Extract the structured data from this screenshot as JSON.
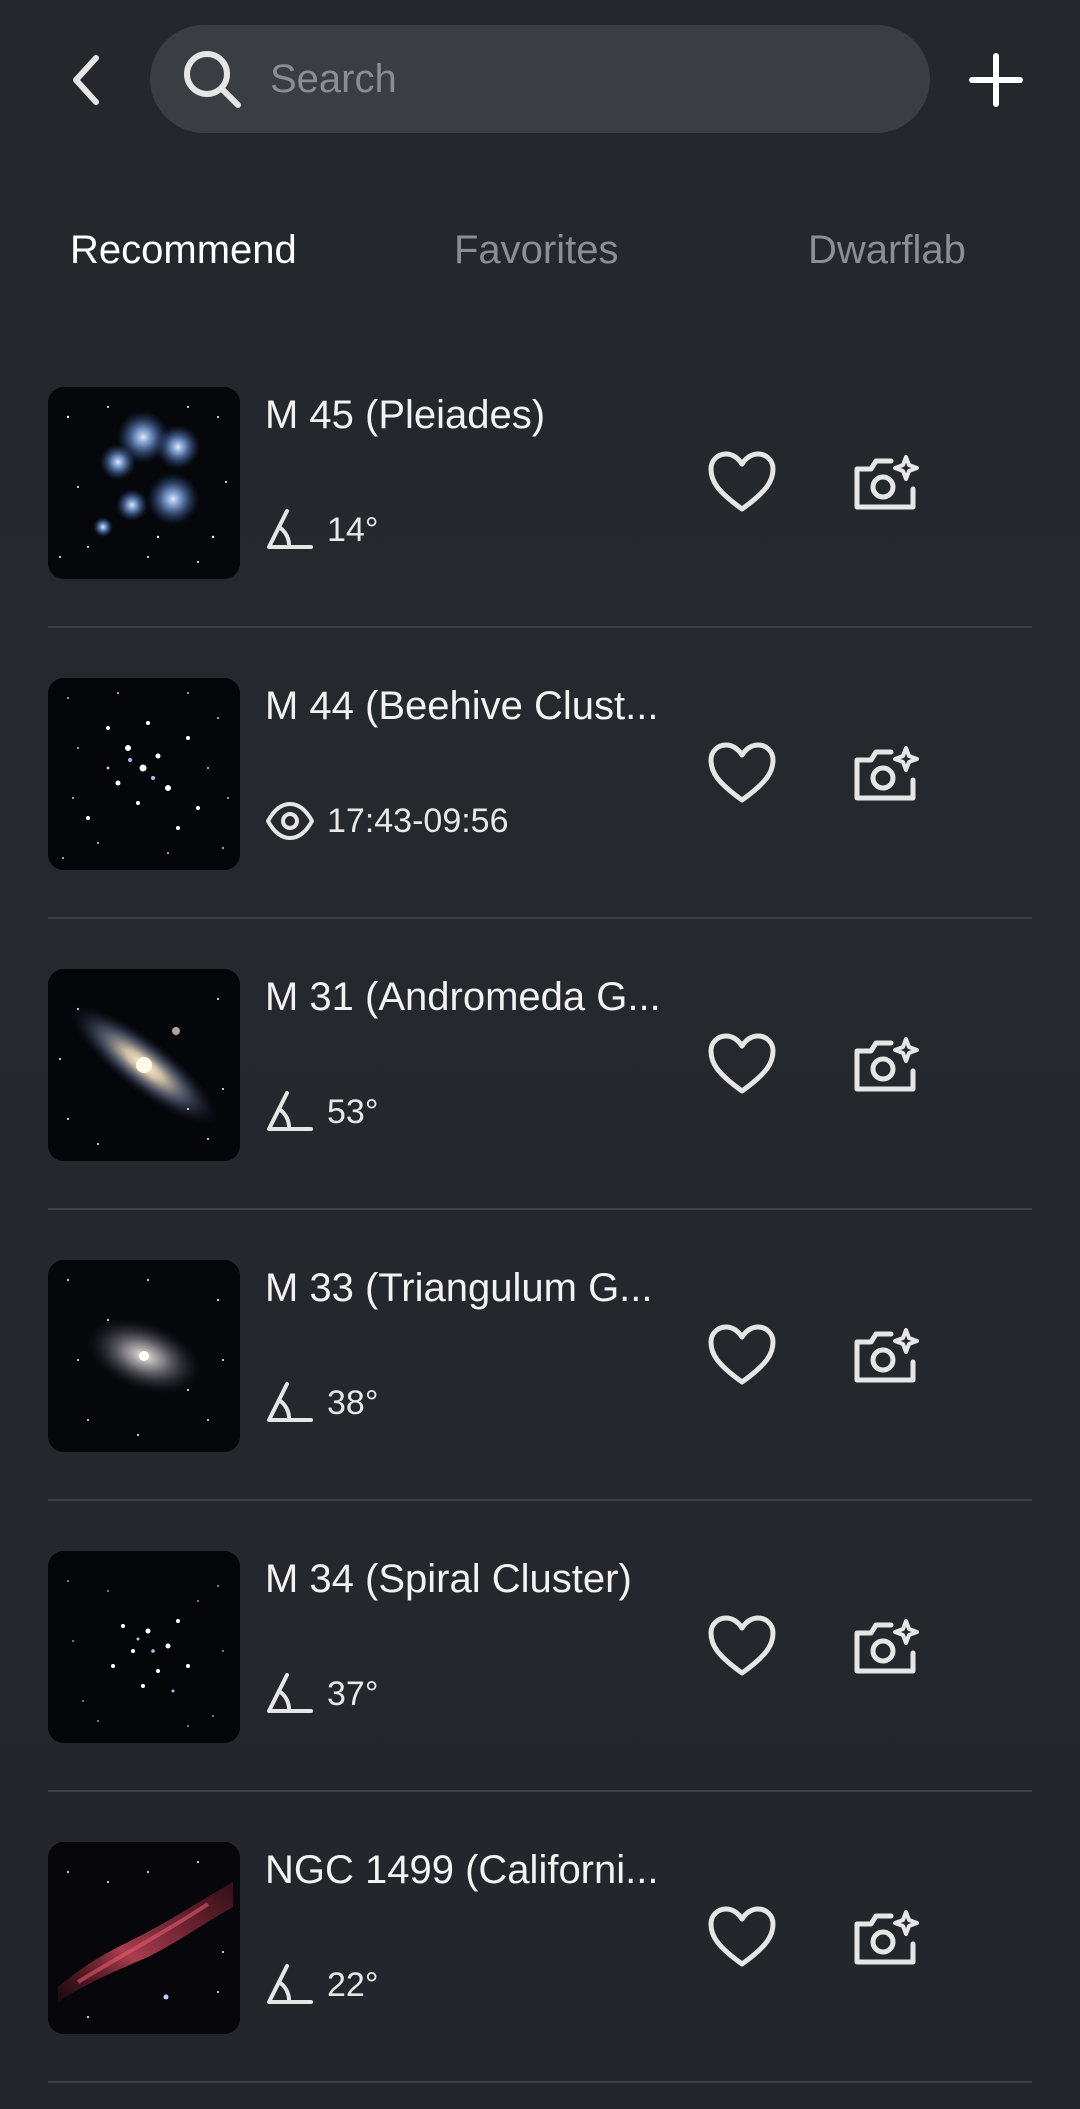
{
  "search": {
    "placeholder": "Search",
    "value": ""
  },
  "tabs": [
    {
      "label": "Recommend",
      "active": true
    },
    {
      "label": "Favorites",
      "active": false
    },
    {
      "label": "Dwarflab",
      "active": false
    }
  ],
  "items": [
    {
      "title": "M 45 (Pleiades)",
      "meta_icon": "altitude-angle-icon",
      "meta": "14°",
      "thumb": "pleiades"
    },
    {
      "title": "M 44 (Beehive Clust...",
      "meta_icon": "visibility-eye-icon",
      "meta": "17:43-09:56",
      "thumb": "beehive"
    },
    {
      "title": "M 31 (Andromeda G...",
      "meta_icon": "altitude-angle-icon",
      "meta": "53°",
      "thumb": "andromeda"
    },
    {
      "title": "M 33 (Triangulum G...",
      "meta_icon": "altitude-angle-icon",
      "meta": "38°",
      "thumb": "triangulum"
    },
    {
      "title": "M 34 (Spiral Cluster)",
      "meta_icon": "altitude-angle-icon",
      "meta": "37°",
      "thumb": "spiral-cluster"
    },
    {
      "title": "NGC 1499 (Californi...",
      "meta_icon": "altitude-angle-icon",
      "meta": "22°",
      "thumb": "california-nebula"
    }
  ],
  "colors": {
    "background": "#24272c",
    "search_bg": "#3a3d42",
    "active_tab": "#ffffff",
    "inactive_tab": "#8b8e93",
    "divider": "#3d4045",
    "icon": "#e6e6e6"
  }
}
